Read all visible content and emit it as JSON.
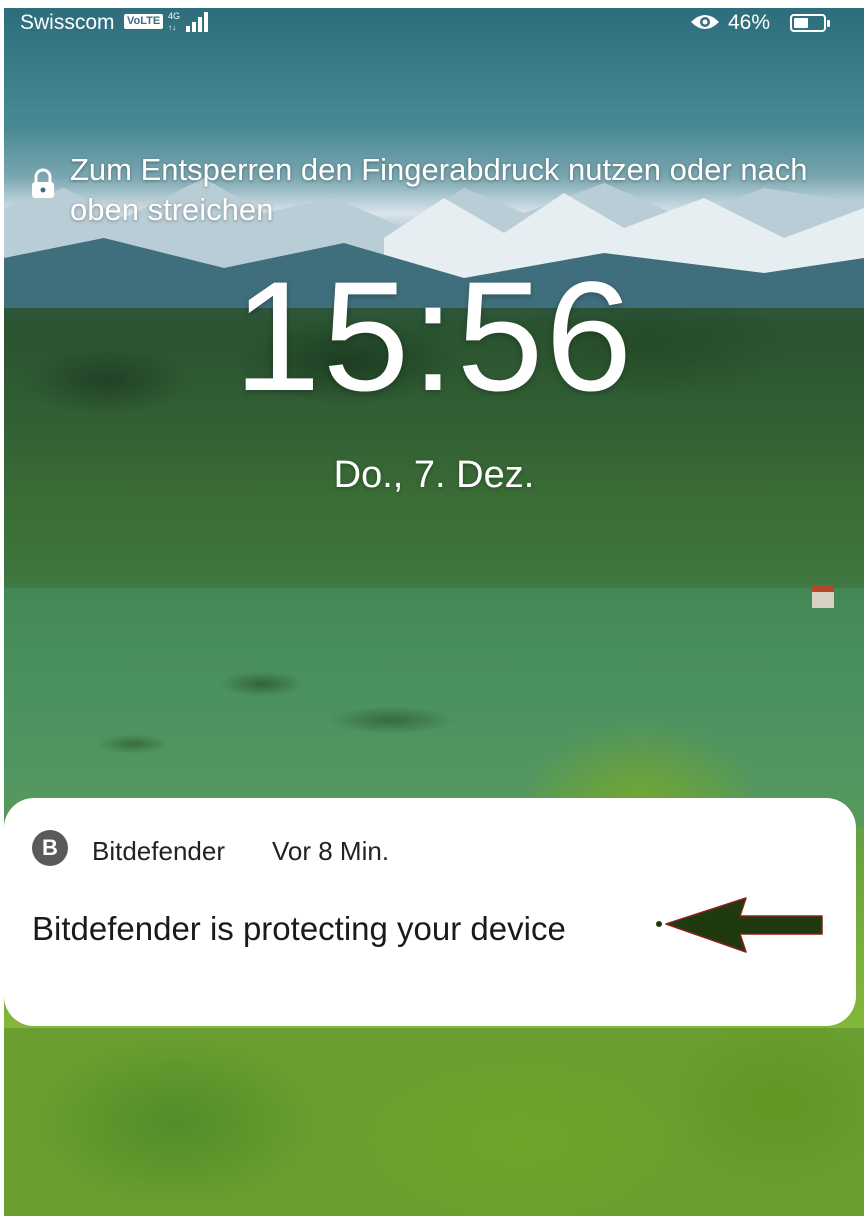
{
  "status_bar": {
    "carrier": "Swisscom",
    "volte_badge": "VoLTE",
    "network": "4G",
    "battery_percent": "46%",
    "icons": [
      "signal-icon",
      "eye-icon",
      "battery-icon"
    ]
  },
  "lock_screen": {
    "unlock_hint": "Zum Entsperren den Fingerabdruck nutzen oder nach oben streichen",
    "time": "15:56",
    "date": "Do., 7. Dez."
  },
  "notification": {
    "app_icon_letter": "B",
    "app_name": "Bitdefender",
    "time_ago": "Vor 8 Min.",
    "message": "Bitdefender is protecting your device"
  },
  "colors": {
    "notification_bg": "#ffffff",
    "arrow": "#1f3a0e",
    "app_icon_bg": "#5a5a5a"
  }
}
